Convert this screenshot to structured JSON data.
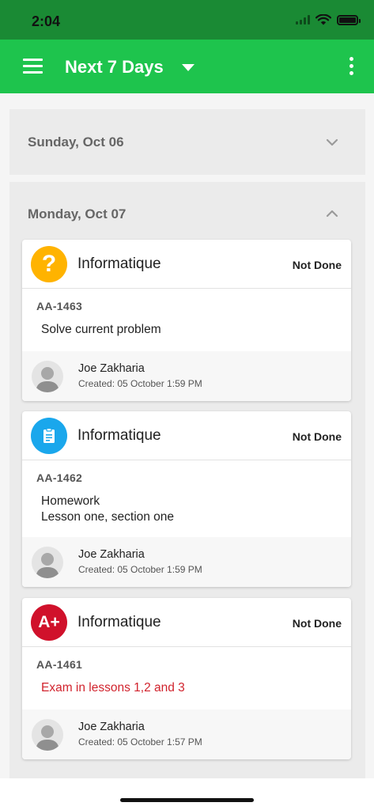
{
  "status_bar": {
    "time": "2:04"
  },
  "app_bar": {
    "title": "Next 7 Days"
  },
  "days": [
    {
      "label": "Sunday, Oct 06",
      "expanded": false
    },
    {
      "label": "Monday, Oct 07",
      "expanded": true
    }
  ],
  "cards": [
    {
      "subject": "Informatique",
      "status": "Not Done",
      "code": "AA-1463",
      "description": "Solve current problem",
      "author": "Joe Zakharia",
      "created": "Created: 05 October 1:59 PM",
      "icon": "question-icon",
      "badge_color": "#ffb300",
      "badge_glyph": "?"
    },
    {
      "subject": "Informatique",
      "status": "Not Done",
      "code": "AA-1462",
      "description": "Homework\nLesson one, section one",
      "author": "Joe Zakharia",
      "created": "Created: 05 October 1:59 PM",
      "icon": "clipboard-icon",
      "badge_color": "#1aa7ec",
      "badge_glyph": ""
    },
    {
      "subject": "Informatique",
      "status": "Not Done",
      "code": "AA-1461",
      "description": "Exam in lessons 1,2 and 3",
      "author": "Joe Zakharia",
      "created": "Created: 05 October 1:57 PM",
      "icon": "grade-a-plus-icon",
      "badge_color": "#d0112b",
      "badge_glyph": "A+"
    }
  ],
  "colors": {
    "app_bar": "#1ec44d",
    "status_bar": "#1a8a34",
    "exam_text": "#d1232d"
  }
}
